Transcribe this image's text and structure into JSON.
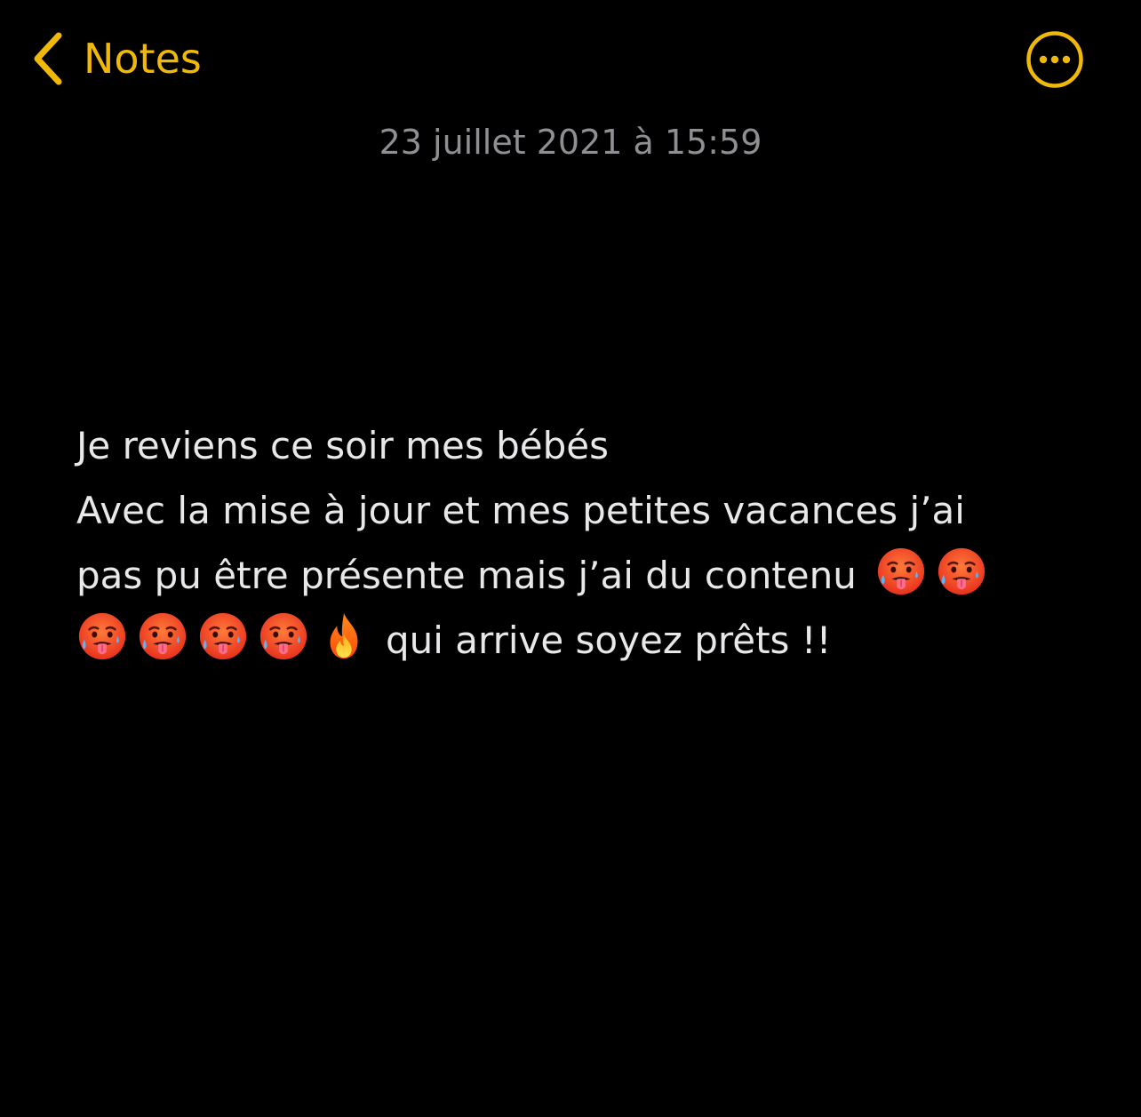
{
  "nav": {
    "back_label": "Notes",
    "back_icon": "chevron-left-icon",
    "more_icon": "ellipsis-circle-icon"
  },
  "note": {
    "date": "23 juillet 2021 à 15:59",
    "line1": "Je reviens ce soir mes bébés",
    "line2": "Avec la mise à jour et mes petites vacances j’ai",
    "line3": "pas pu être présente mais j’ai du contenu",
    "line4": "qui arrive soyez prêts !!",
    "emoji_icons": [
      "hot-face-icon",
      "fire-icon"
    ]
  },
  "colors": {
    "background": "#000000",
    "accent": "#f0b90a",
    "text": "#e8e8ea",
    "secondary_text": "#8e8e93"
  }
}
